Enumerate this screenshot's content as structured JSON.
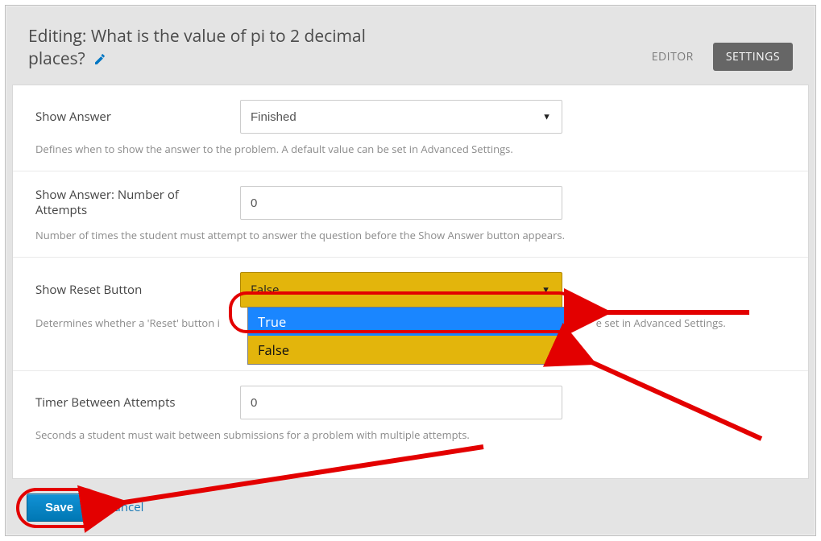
{
  "header": {
    "title_prefix": "Editing: ",
    "title_question": "What is the value of pi to 2 decimal places?",
    "edit_icon": "pencil-icon"
  },
  "tabs": {
    "editor": "EDITOR",
    "settings": "SETTINGS"
  },
  "settings": {
    "show_answer": {
      "label": "Show Answer",
      "value": "Finished",
      "help": "Defines when to show the answer to the problem. A default value can be set in Advanced Settings."
    },
    "show_answer_attempts": {
      "label": "Show Answer: Number of Attempts",
      "value": "0",
      "help": "Number of times the student must attempt to answer the question before the Show Answer button appears."
    },
    "show_reset_button": {
      "label": "Show Reset Button",
      "value": "False",
      "options": [
        "True",
        "False"
      ],
      "highlighted_option": "True",
      "help_left": "Determines whether a 'Reset' button i",
      "help_right": "e set in Advanced Settings."
    },
    "timer_between_attempts": {
      "label": "Timer Between Attempts",
      "value": "0",
      "help": "Seconds a student must wait between submissions for a problem with multiple attempts."
    }
  },
  "footer": {
    "save": "Save",
    "cancel": "Cancel"
  }
}
